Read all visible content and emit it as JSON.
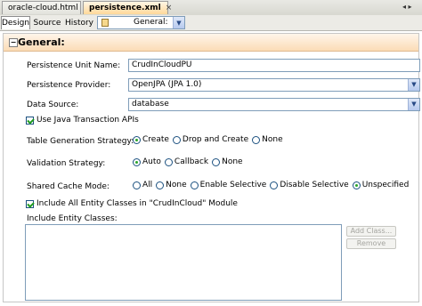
{
  "tabs": [
    {
      "label": "oracle-cloud.html",
      "close": "×"
    },
    {
      "label": "persistence.xml",
      "close": "×"
    }
  ],
  "tab_overflow": "◂ ▸",
  "view_tabs": [
    "Design",
    "Source",
    "History"
  ],
  "section_selector": {
    "value": "General:"
  },
  "section": {
    "title": "General:",
    "collapse": "−"
  },
  "form": {
    "unit_name_label": "Persistence Unit Name:",
    "unit_name_value": "CrudInCloudPU",
    "provider_label": "Persistence Provider:",
    "provider_value": "OpenJPA (JPA 1.0)",
    "datasource_label": "Data Source:",
    "datasource_value": "database",
    "jta_label": "Use Java Transaction APIs",
    "table_gen_label": "Table Generation Strategy:",
    "table_gen_options": [
      "Create",
      "Drop and Create",
      "None"
    ],
    "table_gen_selected": "Create",
    "validation_label": "Validation Strategy:",
    "validation_options": [
      "Auto",
      "Callback",
      "None"
    ],
    "validation_selected": "Auto",
    "cache_label": "Shared Cache Mode:",
    "cache_options": [
      "All",
      "None",
      "Enable Selective",
      "Disable Selective",
      "Unspecified"
    ],
    "cache_selected": "Unspecified",
    "include_all_label": "Include All Entity Classes in \"CrudInCloud\" Module",
    "include_label": "Include Entity Classes:",
    "add_class": "Add Class...",
    "remove": "Remove"
  },
  "colors": {
    "section_header": "#fbdcb6",
    "active_tab": "#ffd89a",
    "field_border": "#7f9db9"
  }
}
